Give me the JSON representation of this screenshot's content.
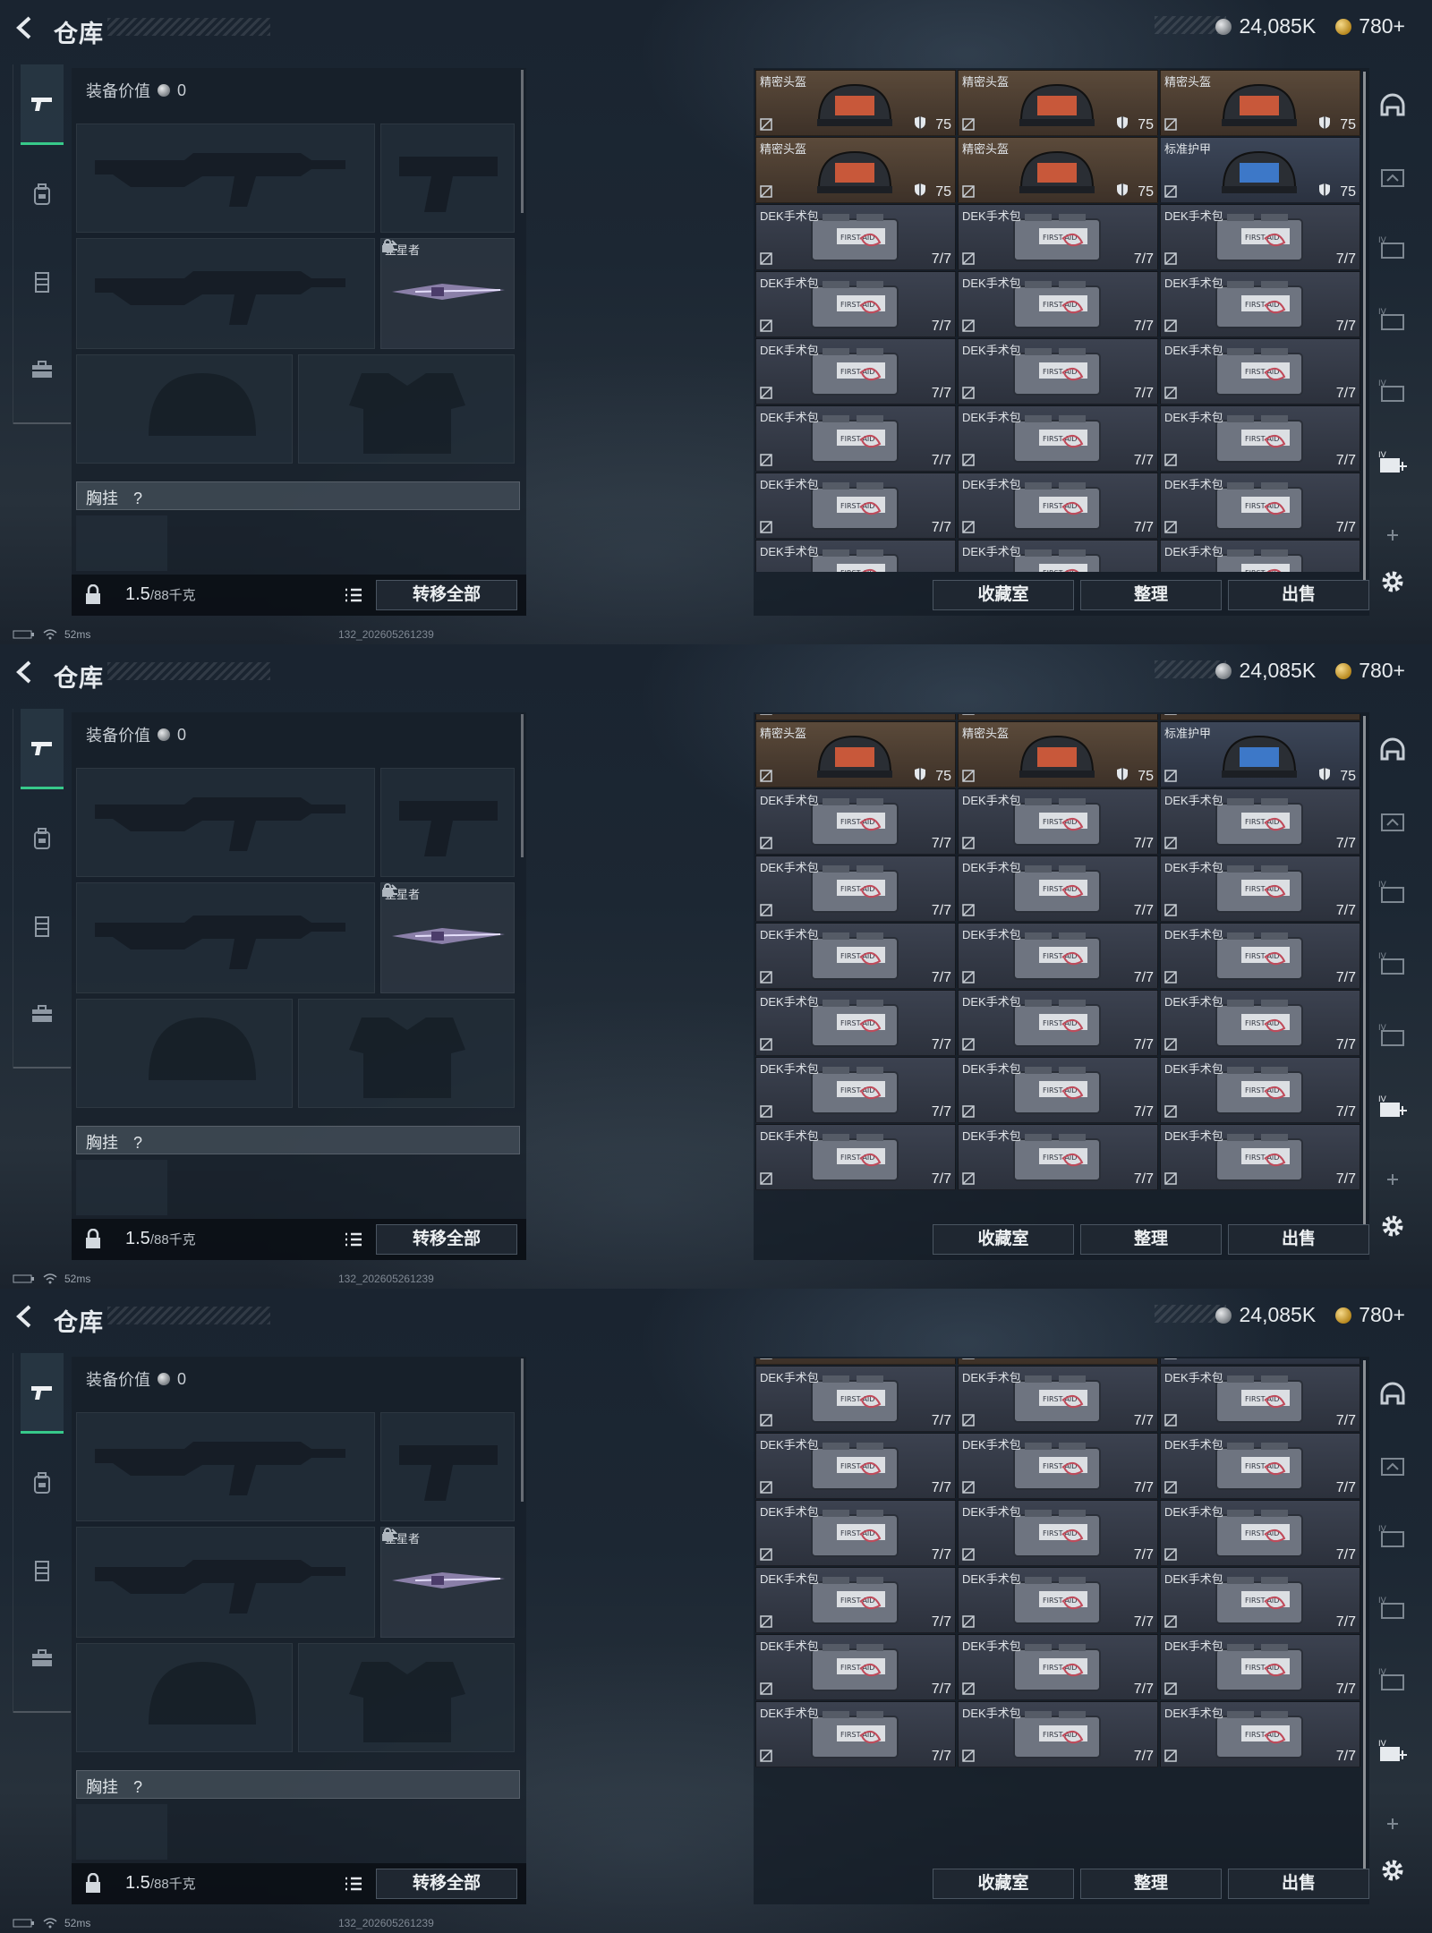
{
  "header": {
    "title": "仓库",
    "currency_silver": "24,085K",
    "currency_gold": "780+"
  },
  "equipment": {
    "value_label": "装备价值",
    "value": "0",
    "melee_name": "坠星者",
    "chest_rig_label": "胸挂",
    "chest_rig_help": "?",
    "weight_value": "1.5",
    "weight_capacity": "/88千克",
    "transfer_all": "转移全部"
  },
  "inventory": {
    "buttons": [
      "收藏室",
      "整理",
      "出售"
    ],
    "rows": [
      [
        {
          "name": "精密头盔",
          "value": "75",
          "kind": "heavy"
        },
        {
          "name": "精密头盔",
          "value": "75",
          "kind": "heavy"
        },
        {
          "name": "精密头盔",
          "value": "75",
          "kind": "heavy"
        }
      ],
      [
        {
          "name": "精密头盔",
          "value": "75",
          "kind": "heavy"
        },
        {
          "name": "精密头盔",
          "value": "75",
          "kind": "heavy"
        },
        {
          "name": "标准护甲",
          "value": "75",
          "kind": "armor"
        }
      ],
      [
        {
          "name": "DEK手术包",
          "value": "7/7",
          "kind": "med"
        },
        {
          "name": "DEK手术包",
          "value": "7/7",
          "kind": "med"
        },
        {
          "name": "DEK手术包",
          "value": "7/7",
          "kind": "med"
        }
      ],
      [
        {
          "name": "DEK手术包",
          "value": "7/7",
          "kind": "med"
        },
        {
          "name": "DEK手术包",
          "value": "7/7",
          "kind": "med"
        },
        {
          "name": "DEK手术包",
          "value": "7/7",
          "kind": "med"
        }
      ],
      [
        {
          "name": "DEK手术包",
          "value": "7/7",
          "kind": "med"
        },
        {
          "name": "DEK手术包",
          "value": "7/7",
          "kind": "med"
        },
        {
          "name": "DEK手术包",
          "value": "7/7",
          "kind": "med"
        }
      ],
      [
        {
          "name": "DEK手术包",
          "value": "7/7",
          "kind": "med"
        },
        {
          "name": "DEK手术包",
          "value": "7/7",
          "kind": "med"
        },
        {
          "name": "DEK手术包",
          "value": "7/7",
          "kind": "med"
        }
      ],
      [
        {
          "name": "DEK手术包",
          "value": "7/7",
          "kind": "med"
        },
        {
          "name": "DEK手术包",
          "value": "7/7",
          "kind": "med"
        },
        {
          "name": "DEK手术包",
          "value": "7/7",
          "kind": "med"
        }
      ],
      [
        {
          "name": "DEK手术包",
          "value": "7/7",
          "kind": "med"
        },
        {
          "name": "DEK手术包",
          "value": "7/7",
          "kind": "med"
        },
        {
          "name": "DEK手术包",
          "value": "7/7",
          "kind": "med"
        }
      ]
    ]
  },
  "status": {
    "ping": "52ms",
    "build": "132_202605261239"
  },
  "frames": [
    {
      "scroll_rows": 0
    },
    {
      "scroll_rows": 0.9
    },
    {
      "scroll_rows": 1.9
    }
  ],
  "icons": {
    "back": "back-arrow-icon",
    "nav": [
      "pistol-icon",
      "backpack-icon",
      "vest-icon",
      "toolbox-icon"
    ],
    "rail": [
      "helmet-icon",
      "case-icon",
      "case-iv-icon",
      "case-iv-icon",
      "case-iv-icon",
      "case-iv-add-icon",
      "plus-icon",
      "gear-icon"
    ]
  },
  "colors": {
    "accent": "#37c98a",
    "heavy_cell": "#5b4a3a",
    "med_cell": "#3c4250",
    "armor_cell": "#3c4658"
  }
}
